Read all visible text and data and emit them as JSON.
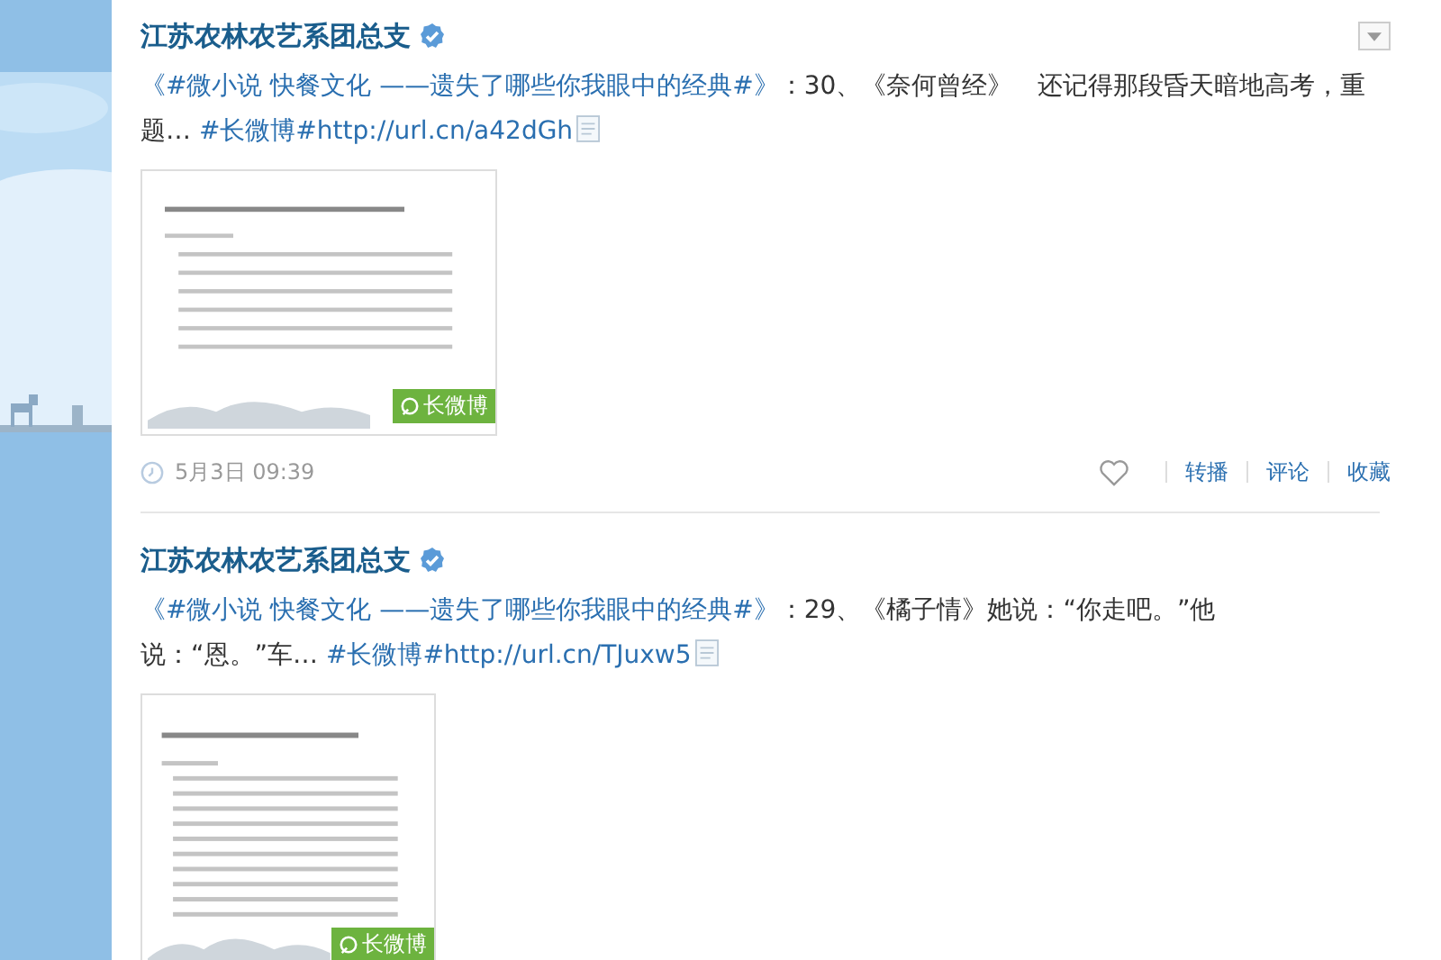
{
  "posts": [
    {
      "author": "江苏农林农艺系团总支",
      "verified": true,
      "show_menu": true,
      "segments": [
        {
          "kind": "link",
          "text": "《#微小说 快餐文化 ——遗失了哪些你我眼中的经典#》"
        },
        {
          "kind": "text",
          "text": "：30、《奈何曾经》　还记得那段昏天暗地高考，重题…"
        },
        {
          "kind": "link",
          "text": " #长微博#http://url.cn/a42dGh"
        }
      ],
      "thumb_badge": "长微博",
      "footer": {
        "time": "5月3日 09:39",
        "actions": [
          "转播",
          "评论",
          "收藏"
        ]
      }
    },
    {
      "author": "江苏农林农艺系团总支",
      "verified": true,
      "show_menu": false,
      "segments": [
        {
          "kind": "link",
          "text": "《#微小说 快餐文化 ——遗失了哪些你我眼中的经典#》"
        },
        {
          "kind": "text",
          "text": "：29、《橘子情》她说：“你走吧。”他说：“恩。”车…"
        },
        {
          "kind": "link",
          "text": " #长微博#http://url.cn/TJuxw5"
        }
      ],
      "thumb_badge": "长微博"
    }
  ]
}
